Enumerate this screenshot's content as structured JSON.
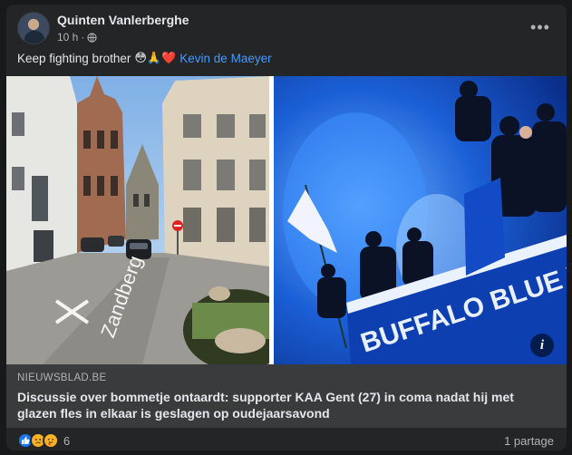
{
  "post": {
    "author": "Quinten Vanlerberghe",
    "time": "10 h",
    "separator": "·",
    "more_label": "•••",
    "message_text": "Keep fighting brother",
    "message_emojis": "😳🙏❤️",
    "mention": "Kevin de Maeyer"
  },
  "media": {
    "street_sign": "Zandberg",
    "banner_text": "BUFFALO BLUE WHITES",
    "info_label": "i"
  },
  "link_preview": {
    "domain": "NIEUWSBLAD.BE",
    "headline": "Discussie over bommetje ontaardt: supporter KAA Gent (27) in coma nadat hij met glazen fles in elkaar is geslagen op oudejaarsavond"
  },
  "footer": {
    "reaction_count": "6",
    "shares": "1 partage",
    "reactions": [
      "like",
      "sad",
      "care"
    ]
  },
  "colors": {
    "background": "#18191a",
    "card": "#242526",
    "link_box": "#3a3b3c",
    "text": "#e4e6eb",
    "muted": "#b0b3b8",
    "mention": "#4599ff",
    "like_blue": "#1877f2"
  }
}
